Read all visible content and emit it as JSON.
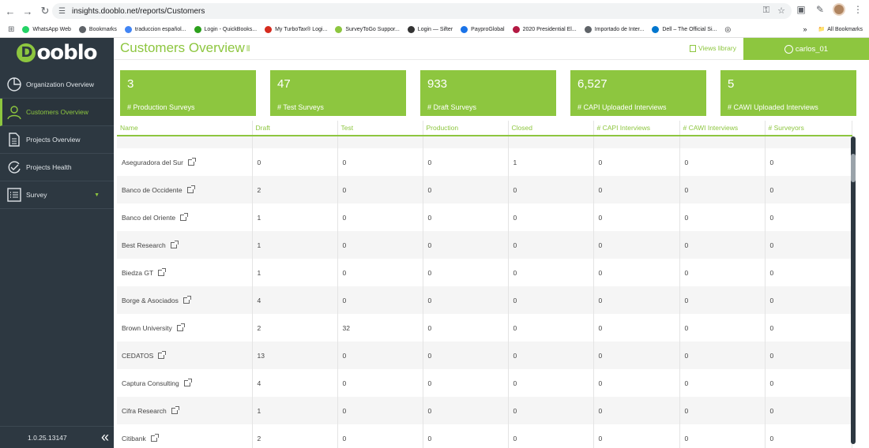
{
  "browser": {
    "url": "insights.dooblo.net/reports/Customers",
    "bookmarks": [
      {
        "label": "WhatsApp Web",
        "color": "#25d366"
      },
      {
        "label": "Bookmarks",
        "color": "#5f6368"
      },
      {
        "label": "traduccion español...",
        "color": "#4285f4"
      },
      {
        "label": "Login - QuickBooks...",
        "color": "#2ca01c"
      },
      {
        "label": "My TurboTax® Logi...",
        "color": "#d52b1e"
      },
      {
        "label": "SurveyToGo Suppor...",
        "color": "#8dc63f"
      },
      {
        "label": "Login — Sifter",
        "color": "#333333"
      },
      {
        "label": "PayproGlobal",
        "color": "#1a73e8"
      },
      {
        "label": "2020 Presidential El...",
        "color": "#b31942"
      },
      {
        "label": "Importado de Inter...",
        "color": "#5f6368"
      },
      {
        "label": "Dell – The Official Si...",
        "color": "#0076ce"
      }
    ],
    "all_bookmarks": "All Bookmarks"
  },
  "app": {
    "logo": "Dooblo",
    "version": "1.0.25.13147",
    "nav": [
      {
        "label": "Organization Overview",
        "icon": "pie-chart-icon"
      },
      {
        "label": "Customers Overview",
        "icon": "user-icon"
      },
      {
        "label": "Projects Overview",
        "icon": "document-icon"
      },
      {
        "label": "Projects Health",
        "icon": "refresh-check-icon"
      },
      {
        "label": "Survey",
        "icon": "list-icon"
      }
    ],
    "accent": "#8dc63f",
    "sidebar_bg": "#2d3841"
  },
  "header": {
    "title": "Customers Overview",
    "views_library": "Views library",
    "user": "carlos_01"
  },
  "cards": [
    {
      "value": "3",
      "label": "# Production Surveys"
    },
    {
      "value": "47",
      "label": "# Test Surveys"
    },
    {
      "value": "933",
      "label": "# Draft Surveys"
    },
    {
      "value": "6,527",
      "label": "# CAPI Uploaded Interviews"
    },
    {
      "value": "5",
      "label": "# CAWI Uploaded Interviews"
    }
  ],
  "table": {
    "columns": [
      "Name",
      "Draft",
      "Test",
      "Production",
      "Closed",
      "# CAPI Interviews",
      "# CAWI Interviews",
      "# Surveyors"
    ],
    "rows": [
      [
        "Aseguradora del Sur",
        "0",
        "0",
        "0",
        "1",
        "0",
        "0",
        "0"
      ],
      [
        "Banco de Occidente",
        "2",
        "0",
        "0",
        "0",
        "0",
        "0",
        "0"
      ],
      [
        "Banco del Oriente",
        "1",
        "0",
        "0",
        "0",
        "0",
        "0",
        "0"
      ],
      [
        "Best Research",
        "1",
        "0",
        "0",
        "0",
        "0",
        "0",
        "0"
      ],
      [
        "Biedza GT",
        "1",
        "0",
        "0",
        "0",
        "0",
        "0",
        "0"
      ],
      [
        "Borge & Asociados",
        "4",
        "0",
        "0",
        "0",
        "0",
        "0",
        "0"
      ],
      [
        "Brown University",
        "2",
        "32",
        "0",
        "0",
        "0",
        "0",
        "0"
      ],
      [
        "CEDATOS",
        "13",
        "0",
        "0",
        "0",
        "0",
        "0",
        "0"
      ],
      [
        "Captura Consulting",
        "4",
        "0",
        "0",
        "0",
        "0",
        "0",
        "0"
      ],
      [
        "Cifra Research",
        "1",
        "0",
        "0",
        "0",
        "0",
        "0",
        "0"
      ],
      [
        "Citibank",
        "2",
        "0",
        "0",
        "0",
        "0",
        "0",
        "0"
      ]
    ]
  }
}
